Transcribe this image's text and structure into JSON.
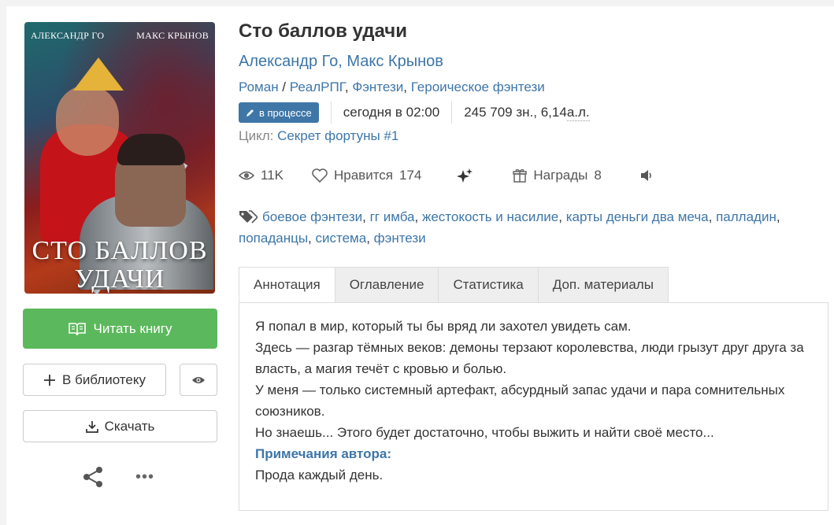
{
  "book": {
    "title": "Сто баллов удачи",
    "authors": [
      "Александр Го",
      "Макс Крынов"
    ],
    "author_separator": ", ",
    "genres": {
      "main": "Роман",
      "slash": " / ",
      "list": [
        "РеалРПГ",
        "Фэнтези",
        "Героическое фэнтези"
      ]
    },
    "status_badge": "в процессе",
    "updated": "сегодня в 02:00",
    "size": "245 709 зн., 6,14 ",
    "size_unit": "а.л.",
    "cycle_label": "Цикл: ",
    "cycle_name": "Секрет фортуны #1"
  },
  "cover": {
    "author_left": "АЛЕКСАНДР ГО",
    "author_right": "МАКС КРЫНОВ",
    "title_line1": "СТО БАЛЛОВ",
    "title_line2": "УДАЧИ"
  },
  "stats": {
    "views": "11K",
    "likes_label": "Нравится",
    "likes": "174",
    "awards_label": "Награды",
    "awards": "8"
  },
  "tags": [
    "боевое фэнтези",
    "гг имба",
    "жестокость и насилие",
    "карты деньги два меча",
    "палладин",
    "попаданцы",
    "система",
    "фэнтези"
  ],
  "actions": {
    "read": "Читать книгу",
    "library": "В библиотеку",
    "download": "Скачать"
  },
  "tabs": [
    "Аннотация",
    "Оглавление",
    "Статистика",
    "Доп. материалы"
  ],
  "annotation": {
    "lines": [
      "Я попал в мир, который ты бы вряд ли захотел увидеть сам.",
      "Здесь — разгар тёмных веков: демоны терзают королевства, люди грызут друг друга за власть, а магия течёт с кровью и болью.",
      "У меня — только системный артефакт, абсурдный запас удачи и пара сомнительных союзников.",
      "Но знаешь... Этого будет достаточно, чтобы выжить и найти своё место..."
    ],
    "notes_title": "Примечания автора:",
    "notes_text": "Прода каждый день."
  },
  "colors": {
    "link": "#3e76a8",
    "read_button": "#5cb85c",
    "badge": "#3e76a8"
  }
}
